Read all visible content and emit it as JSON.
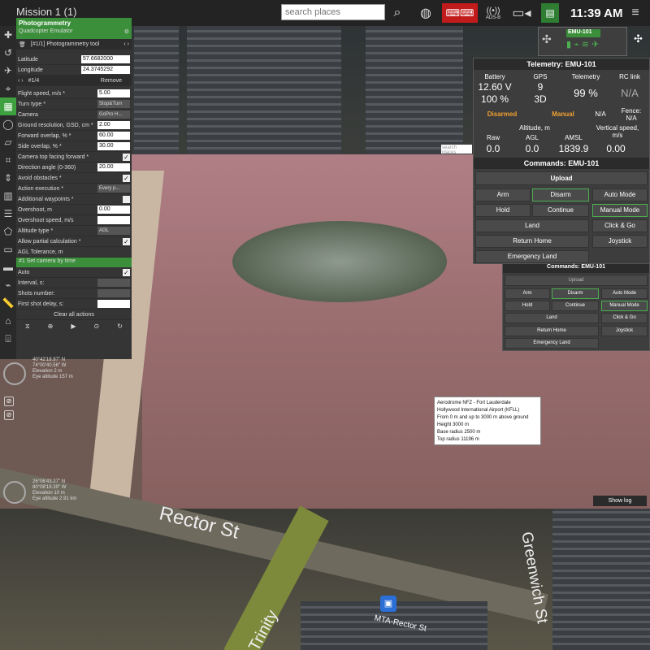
{
  "topbar": {
    "title": "Mission 1 (1)",
    "search_placeholder": "search places",
    "clock": "11:39 AM",
    "icons": [
      "search-icon",
      "globe-icon",
      "keyboard-icon",
      "ads-b-icon",
      "video-icon",
      "clipboard-icon",
      "menu-icon"
    ],
    "adsb": "ADS-B"
  },
  "plan": {
    "header": "Photogrammetry",
    "vehicle": "Quadcopter Emulator",
    "tool": "[#1/1] Photogrammetry tool",
    "lat_label": "Latitude",
    "lat_value": "57.6682000",
    "lon_label": "Longitude",
    "lon_value": "24.3745292",
    "wp_index": "#1/4",
    "remove": "Remove",
    "params": [
      {
        "k": "Flight speed, m/s *",
        "v": "5.00",
        "t": "v"
      },
      {
        "k": "Turn type *",
        "v": "Stop&Turn",
        "t": "d"
      },
      {
        "k": "Camera",
        "v": "GoPro H...",
        "t": "d"
      },
      {
        "k": "Ground resolution, GSD, cm *",
        "v": "2.00",
        "t": "v"
      },
      {
        "k": "Forward overlap, % *",
        "v": "60.00",
        "t": "v"
      },
      {
        "k": "Side overlap, % *",
        "v": "30.00",
        "t": "v"
      },
      {
        "k": "Camera top facing forward *",
        "v": "✓",
        "t": "c"
      },
      {
        "k": "Direction angle (0-360)",
        "v": "20.00",
        "t": "v"
      },
      {
        "k": "Avoid obstacles *",
        "v": "✓",
        "t": "c"
      },
      {
        "k": "Action execution *",
        "v": "Every p...",
        "t": "d"
      },
      {
        "k": "Additional waypoints *",
        "v": "",
        "t": "c"
      },
      {
        "k": "Overshoot, m",
        "v": "0.00",
        "t": "v"
      },
      {
        "k": "Overshoot speed, m/s",
        "v": "",
        "t": "v"
      },
      {
        "k": "Altitude type *",
        "v": "AGL",
        "t": "d"
      },
      {
        "k": "Allow partial calculation *",
        "v": "✓",
        "t": "c"
      }
    ],
    "clip": "AGL Tolerance, m",
    "action": "#1 Set camera by time",
    "auto": "Auto",
    "interval": "Interval, s:",
    "shots": "Shots number:",
    "delay": "First shot delay, s:",
    "clear": "Clear all actions"
  },
  "overlays": {
    "a1": "40°42'18.97\" N",
    "a2": "74°00'40.56\" W",
    "a3": "Elevation 2 m",
    "a4": "Eye altitude 157 m",
    "b1": "26°06'43.27\" N",
    "b2": "80°08'19.39\" W",
    "b3": "Elevation 10 m",
    "b4": "Eye altitude 2.91 km",
    "search": "search places"
  },
  "vehicle": {
    "name": "EMU-101"
  },
  "telemetry": {
    "title": "Telemetry: EMU-101",
    "battery_label": "Battery",
    "battery_v": "12.60 V",
    "battery_pct": "100 %",
    "gps_label": "GPS",
    "gps_sats": "9",
    "gps_fix": "3D",
    "tele_label": "Telemetry",
    "tele_val": "99 %",
    "rc_label": "RC link",
    "rc_val": "N/A",
    "armed": "Disarmed",
    "mode": "Manual",
    "na": "N/A",
    "fence": "Fence:",
    "fence_val": "N/A",
    "alt_label": "Altitude, m",
    "raw": "Raw",
    "raw_v": "0.0",
    "agl": "AGL",
    "agl_v": "0.0",
    "amsl": "AMSL",
    "amsl_v": "1839.9",
    "vs_label": "Vertical speed, m/s",
    "vs_v": "0.00"
  },
  "commands": {
    "title": "Commands: EMU-101",
    "upload": "Upload",
    "arm": "Arm",
    "disarm": "Disarm",
    "auto": "Auto Mode",
    "hold": "Hold",
    "continue": "Continue",
    "manual": "Manual Mode",
    "land": "Land",
    "clickgo": "Click & Go",
    "rth": "Return Home",
    "joystick": "Joystick",
    "eland": "Emergency Land"
  },
  "nfz": {
    "l1": "Aerodrome NFZ - Fort Lauderdale",
    "l2": "Hollywood International Airport (KFLL)",
    "l3": "From 0 m and up to 3000 m above ground",
    "l4": "Height 3000 m",
    "l5": "Base radius 2500 m",
    "l6": "Top radius 11196 m"
  },
  "showlog": "Show log",
  "streets": {
    "s1": "Rector St",
    "s2": "Greenwich St",
    "s3": "Trinity",
    "s4": "MTA-Rector St"
  }
}
